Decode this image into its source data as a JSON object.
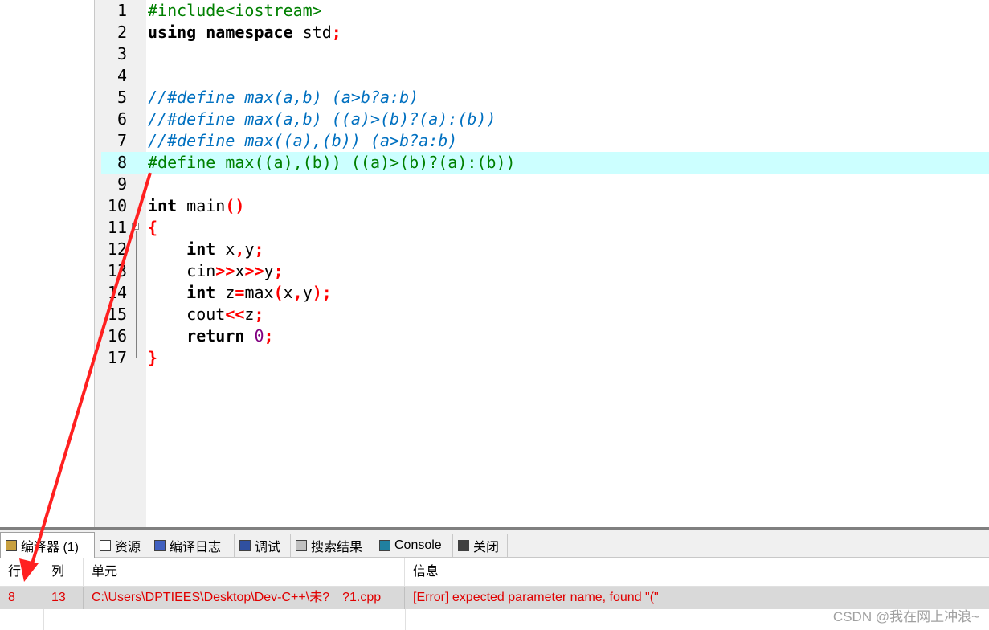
{
  "editor": {
    "lines": [
      {
        "n": "1",
        "parts": [
          {
            "t": "#include<iostream>",
            "c": "pp"
          }
        ]
      },
      {
        "n": "2",
        "parts": [
          {
            "t": "using namespace ",
            "c": "kw"
          },
          {
            "t": "std",
            "c": ""
          },
          {
            "t": ";",
            "c": "sym"
          }
        ]
      },
      {
        "n": "3",
        "parts": []
      },
      {
        "n": "4",
        "parts": []
      },
      {
        "n": "5",
        "parts": [
          {
            "t": "//#define max(a,b) (a>b?a:b)",
            "c": "cm"
          }
        ]
      },
      {
        "n": "6",
        "parts": [
          {
            "t": "//#define max(a,b) ((a)>(b)?(a):(b))",
            "c": "cm"
          }
        ]
      },
      {
        "n": "7",
        "parts": [
          {
            "t": "//#define max((a),(b)) (a>b?a:b)",
            "c": "cm"
          }
        ]
      },
      {
        "n": "8",
        "parts": [
          {
            "t": "#define max((a),(b)) ((a)>(b)?(a):(b))",
            "c": "pp"
          }
        ],
        "highlight": true
      },
      {
        "n": "9",
        "parts": []
      },
      {
        "n": "10",
        "parts": [
          {
            "t": "int ",
            "c": "kw"
          },
          {
            "t": "main",
            "c": ""
          },
          {
            "t": "()",
            "c": "sym"
          }
        ]
      },
      {
        "n": "11",
        "parts": [
          {
            "t": "{",
            "c": "sym"
          }
        ]
      },
      {
        "n": "12",
        "parts": [
          {
            "t": "    ",
            "c": ""
          },
          {
            "t": "int ",
            "c": "kw"
          },
          {
            "t": "x",
            "c": ""
          },
          {
            "t": ",",
            "c": "sym"
          },
          {
            "t": "y",
            "c": ""
          },
          {
            "t": ";",
            "c": "sym"
          }
        ]
      },
      {
        "n": "13",
        "parts": [
          {
            "t": "    cin",
            "c": ""
          },
          {
            "t": ">>",
            "c": "sym"
          },
          {
            "t": "x",
            "c": ""
          },
          {
            "t": ">>",
            "c": "sym"
          },
          {
            "t": "y",
            "c": ""
          },
          {
            "t": ";",
            "c": "sym"
          }
        ]
      },
      {
        "n": "14",
        "parts": [
          {
            "t": "    ",
            "c": ""
          },
          {
            "t": "int ",
            "c": "kw"
          },
          {
            "t": "z",
            "c": ""
          },
          {
            "t": "=",
            "c": "sym"
          },
          {
            "t": "max",
            "c": ""
          },
          {
            "t": "(",
            "c": "sym"
          },
          {
            "t": "x",
            "c": ""
          },
          {
            "t": ",",
            "c": "sym"
          },
          {
            "t": "y",
            "c": ""
          },
          {
            "t": ");",
            "c": "sym"
          }
        ]
      },
      {
        "n": "15",
        "parts": [
          {
            "t": "    cout",
            "c": ""
          },
          {
            "t": "<<",
            "c": "sym"
          },
          {
            "t": "z",
            "c": ""
          },
          {
            "t": ";",
            "c": "sym"
          }
        ]
      },
      {
        "n": "16",
        "parts": [
          {
            "t": "    ",
            "c": ""
          },
          {
            "t": "return ",
            "c": "kw"
          },
          {
            "t": "0",
            "c": "num"
          },
          {
            "t": ";",
            "c": "sym"
          }
        ]
      },
      {
        "n": "17",
        "parts": [
          {
            "t": "}",
            "c": "sym"
          }
        ]
      }
    ]
  },
  "fold_marker": "−",
  "tabs": [
    {
      "label": "编译器 (1)",
      "icon": "compiler-icon",
      "icon_color": "#c8a040"
    },
    {
      "label": "资源",
      "icon": "resource-icon",
      "icon_color": "#ffffff"
    },
    {
      "label": "编译日志",
      "icon": "compile-log-icon",
      "icon_color": "#4060c0"
    },
    {
      "label": "调试",
      "icon": "debug-icon",
      "icon_color": "#3050a0"
    },
    {
      "label": "搜索结果",
      "icon": "search-results-icon",
      "icon_color": "#c0c0c0"
    },
    {
      "label": "Console",
      "icon": "console-icon",
      "icon_color": "#2080a0"
    },
    {
      "label": "关闭",
      "icon": "close-floppy-icon",
      "icon_color": "#404040"
    }
  ],
  "messages": {
    "headers": {
      "line": "行",
      "col": "列",
      "unit": "单元",
      "info": "信息"
    },
    "rows": [
      {
        "line": "8",
        "col": "13",
        "unit": "C:\\Users\\DPTIEES\\Desktop\\Dev-C++\\未?　?1.cpp",
        "info": "[Error] expected parameter name, found \"(\""
      }
    ]
  },
  "watermark": "CSDN @我在网上冲浪~",
  "colors": {
    "highlight": "#ccffff",
    "error": "#e00000",
    "annotation_arrow": "#ff2020"
  }
}
